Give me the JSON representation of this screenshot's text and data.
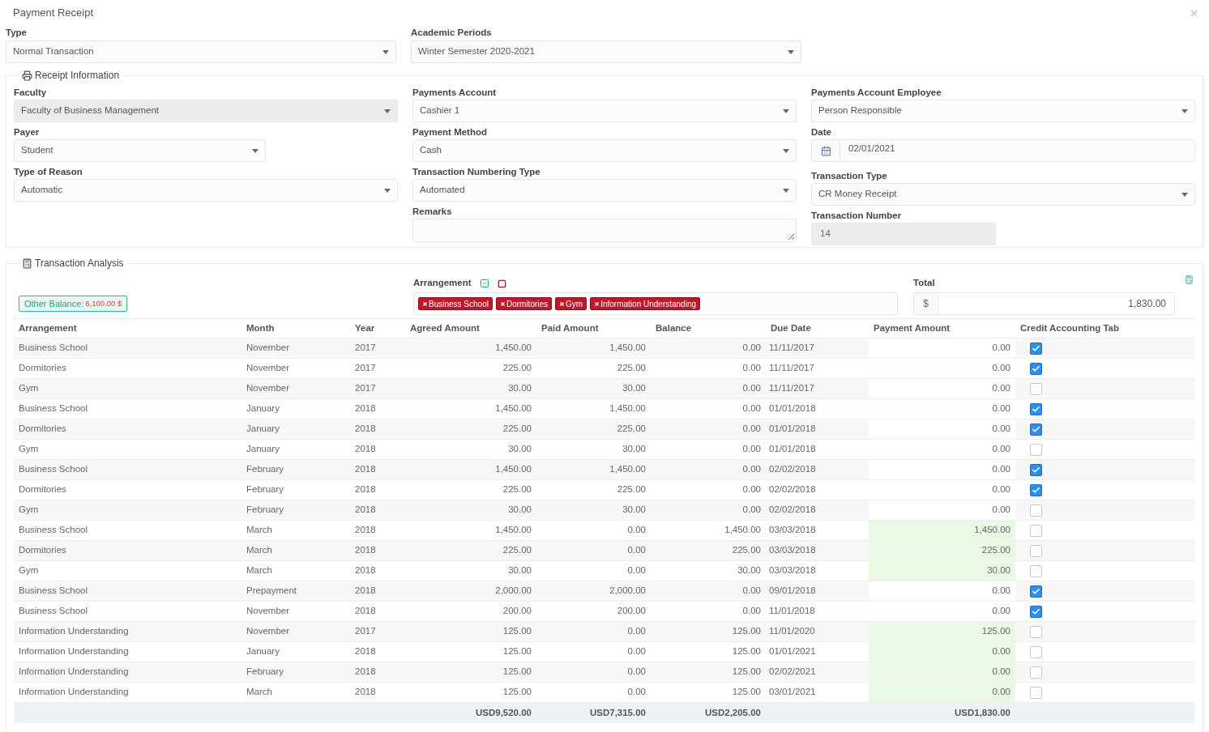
{
  "window": {
    "title": "Payment Receipt"
  },
  "top_fields": [
    {
      "label": "Type",
      "value": "Normal Transaction"
    },
    {
      "label": "Academic Periods",
      "value": "Winter Semester 2020-2021"
    }
  ],
  "receipt_information": {
    "legend": "Receipt Information",
    "columns": [
      [
        {
          "kind": "select",
          "label": "Faculty",
          "value": "Faculty of Business Management",
          "disabled": true
        },
        {
          "kind": "select",
          "label": "Payer",
          "value": "Student",
          "disabled": false,
          "narrow": true
        },
        {
          "kind": "select",
          "label": "Type of Reason",
          "value": "Automatic",
          "disabled": false
        }
      ],
      [
        {
          "kind": "select",
          "label": "Payments Account",
          "value": "Cashier 1",
          "disabled": false
        },
        {
          "kind": "select",
          "label": "Payment Method",
          "value": "Cash",
          "disabled": false
        },
        {
          "kind": "select",
          "label": "Transaction Numbering Type",
          "value": "Automated",
          "disabled": false
        },
        {
          "kind": "textarea",
          "label": "Remarks",
          "disabled": false
        }
      ],
      [
        {
          "kind": "select",
          "label": "Payments Account Employee",
          "value": "Person Responsible",
          "disabled": false
        },
        {
          "kind": "date",
          "label": "Date",
          "value": "02/01/2021",
          "disabled": false
        },
        {
          "kind": "select",
          "label": "Transaction Type",
          "value": "CR Money Receipt",
          "disabled": false
        },
        {
          "kind": "text",
          "label": "Transaction Number",
          "value": "14",
          "disabled": true,
          "narrow": true
        }
      ]
    ]
  },
  "transaction_analysis": {
    "legend": "Transaction Analysis",
    "other_balance": {
      "label": "Other Balance:",
      "amount": "6,100.00 $"
    },
    "arrangement": {
      "label": "Arrangement",
      "tags": [
        "Business School",
        "Dormitories",
        "Gym",
        "Information Understanding"
      ]
    },
    "total": {
      "label": "Total",
      "currency_symbol": "$",
      "value": "1,830.00"
    },
    "table": {
      "columns": [
        "Arrangement",
        "Month",
        "Year",
        "Agreed Amount",
        "Paid Amount",
        "Balance",
        "Due Date",
        "Payment Amount",
        "Credit Accounting Tab"
      ],
      "rows": [
        {
          "arrangement": "Business School",
          "month": "November",
          "year": "2017",
          "agreed": "1,450.00",
          "paid": "1,450.00",
          "balance": "0.00",
          "due_date": "11/11/2017",
          "payment": "0.00",
          "editable": false,
          "checked": true
        },
        {
          "arrangement": "Dormitories",
          "month": "November",
          "year": "2017",
          "agreed": "225.00",
          "paid": "225.00",
          "balance": "0.00",
          "due_date": "11/11/2017",
          "payment": "0.00",
          "editable": false,
          "checked": true
        },
        {
          "arrangement": "Gym",
          "month": "November",
          "year": "2017",
          "agreed": "30.00",
          "paid": "30.00",
          "balance": "0.00",
          "due_date": "11/11/2017",
          "payment": "0.00",
          "editable": false,
          "checked": false
        },
        {
          "arrangement": "Business School",
          "month": "January",
          "year": "2018",
          "agreed": "1,450.00",
          "paid": "1,450.00",
          "balance": "0.00",
          "due_date": "01/01/2018",
          "payment": "0.00",
          "editable": false,
          "checked": true
        },
        {
          "arrangement": "Dormitories",
          "month": "January",
          "year": "2018",
          "agreed": "225.00",
          "paid": "225.00",
          "balance": "0.00",
          "due_date": "01/01/2018",
          "payment": "0.00",
          "editable": false,
          "checked": true
        },
        {
          "arrangement": "Gym",
          "month": "January",
          "year": "2018",
          "agreed": "30.00",
          "paid": "30.00",
          "balance": "0.00",
          "due_date": "01/01/2018",
          "payment": "0.00",
          "editable": false,
          "checked": false
        },
        {
          "arrangement": "Business School",
          "month": "February",
          "year": "2018",
          "agreed": "1,450.00",
          "paid": "1,450.00",
          "balance": "0.00",
          "due_date": "02/02/2018",
          "payment": "0.00",
          "editable": false,
          "checked": true
        },
        {
          "arrangement": "Dormitories",
          "month": "February",
          "year": "2018",
          "agreed": "225.00",
          "paid": "225.00",
          "balance": "0.00",
          "due_date": "02/02/2018",
          "payment": "0.00",
          "editable": false,
          "checked": true
        },
        {
          "arrangement": "Gym",
          "month": "February",
          "year": "2018",
          "agreed": "30.00",
          "paid": "30.00",
          "balance": "0.00",
          "due_date": "02/02/2018",
          "payment": "0.00",
          "editable": false,
          "checked": false
        },
        {
          "arrangement": "Business School",
          "month": "March",
          "year": "2018",
          "agreed": "1,450.00",
          "paid": "0.00",
          "balance": "1,450.00",
          "due_date": "03/03/2018",
          "payment": "1,450.00",
          "editable": true,
          "checked": false
        },
        {
          "arrangement": "Dormitories",
          "month": "March",
          "year": "2018",
          "agreed": "225.00",
          "paid": "0.00",
          "balance": "225.00",
          "due_date": "03/03/2018",
          "payment": "225.00",
          "editable": true,
          "checked": false
        },
        {
          "arrangement": "Gym",
          "month": "March",
          "year": "2018",
          "agreed": "30.00",
          "paid": "0.00",
          "balance": "30.00",
          "due_date": "03/03/2018",
          "payment": "30.00",
          "editable": true,
          "checked": false
        },
        {
          "arrangement": "Business School",
          "month": "Prepayment",
          "year": "2018",
          "agreed": "2,000.00",
          "paid": "2,000.00",
          "balance": "0.00",
          "due_date": "09/01/2018",
          "payment": "0.00",
          "editable": false,
          "checked": true
        },
        {
          "arrangement": "Business School",
          "month": "November",
          "year": "2018",
          "agreed": "200.00",
          "paid": "200.00",
          "balance": "0.00",
          "due_date": "11/01/2018",
          "payment": "0.00",
          "editable": false,
          "checked": true
        },
        {
          "arrangement": "Information Understanding",
          "month": "November",
          "year": "2017",
          "agreed": "125.00",
          "paid": "0.00",
          "balance": "125.00",
          "due_date": "11/01/2020",
          "payment": "125.00",
          "editable": true,
          "checked": false
        },
        {
          "arrangement": "Information Understanding",
          "month": "January",
          "year": "2018",
          "agreed": "125.00",
          "paid": "0.00",
          "balance": "125.00",
          "due_date": "01/01/2021",
          "payment": "0.00",
          "editable": true,
          "checked": false
        },
        {
          "arrangement": "Information Understanding",
          "month": "February",
          "year": "2018",
          "agreed": "125.00",
          "paid": "0.00",
          "balance": "125.00",
          "due_date": "02/02/2021",
          "payment": "0.00",
          "editable": true,
          "checked": false
        },
        {
          "arrangement": "Information Understanding",
          "month": "March",
          "year": "2018",
          "agreed": "125.00",
          "paid": "0.00",
          "balance": "125.00",
          "due_date": "03/01/2021",
          "payment": "0.00",
          "editable": true,
          "checked": false
        }
      ],
      "totals": {
        "agreed": "USD9,520.00",
        "paid": "USD7,315.00",
        "balance": "USD2,205.00",
        "payment": "USD1,830.00"
      }
    }
  }
}
